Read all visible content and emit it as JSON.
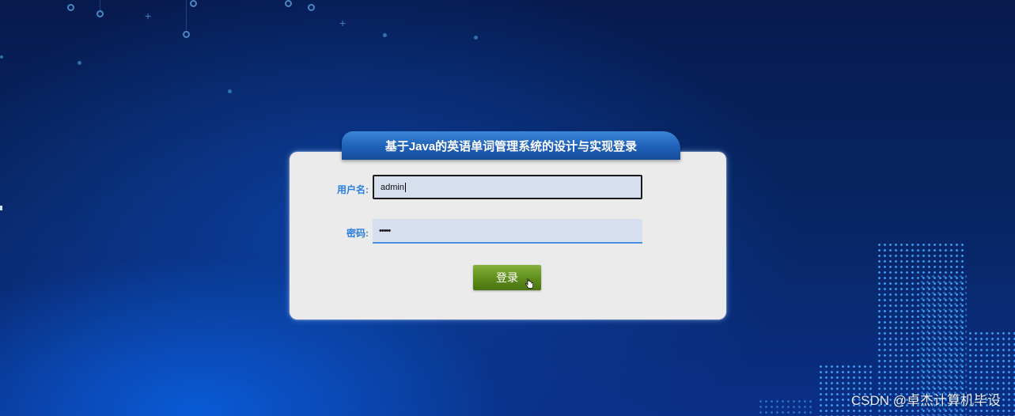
{
  "header": {
    "title": "基于Java的英语单词管理系统的设计与实现登录"
  },
  "form": {
    "username_label": "用户名:",
    "username_value": "admin",
    "password_label": "密码:",
    "password_value": "•••••",
    "login_label": "登录"
  },
  "watermark": "CSDN @卓杰计算机毕设",
  "colors": {
    "accent": "#2a7de1",
    "title_bar": "#1f5fb7",
    "login_button": "#5e8d1c",
    "panel": "#ebebeb",
    "input_bg": "#d5dfee"
  },
  "icons": [
    "gear-icon",
    "plus-icon",
    "pointer-cursor-icon"
  ]
}
